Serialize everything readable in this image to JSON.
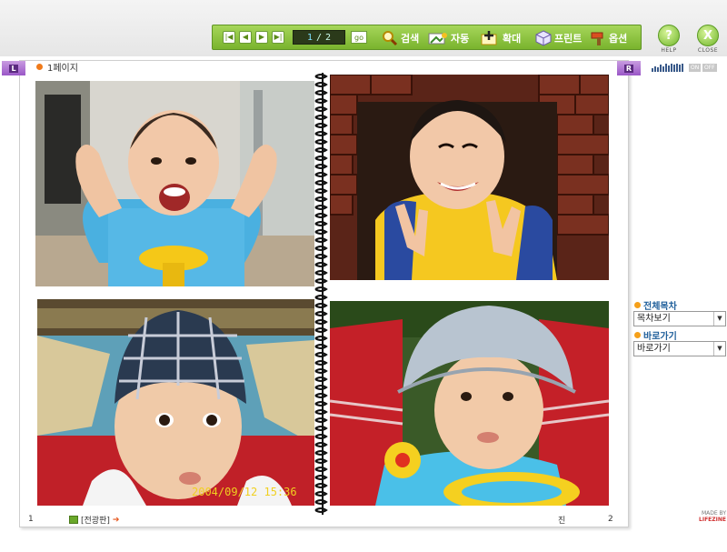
{
  "toolbar": {
    "page_current": "1",
    "page_sep": "/",
    "page_total": "2",
    "go_label": "go",
    "tools": [
      {
        "label": "검색",
        "icon": "search-icon"
      },
      {
        "label": "자동",
        "icon": "auto-icon"
      },
      {
        "label": "확대",
        "icon": "zoom-icon"
      },
      {
        "label": "프린트",
        "icon": "print-icon"
      },
      {
        "label": "옵션",
        "icon": "option-icon"
      }
    ],
    "help_label": "HELP",
    "close_label": "CLOSE",
    "help_glyph": "?",
    "close_glyph": "X"
  },
  "book": {
    "left_tag": "L",
    "right_tag": "R",
    "page_title": "1페이지",
    "page_left_num": "1",
    "page_right_num": "2",
    "prev_label": "[전광판]",
    "mid_label": "진",
    "timestamp": "2004/09/12 15:36"
  },
  "sidebar": {
    "onoff_on": "ON",
    "onoff_off": "OFF",
    "toc_title": "전체목차",
    "toc_select": "목차보기",
    "goto_title": "바로가기",
    "goto_select": "바로가기"
  },
  "branding": {
    "made_by": "MADE BY",
    "brand": "LIFEZINE"
  },
  "colors": {
    "toolbar": "#79b32d",
    "accent_orange": "#f07a1a",
    "tag_purple": "#9a57c7",
    "link_blue": "#1e5e9a"
  }
}
